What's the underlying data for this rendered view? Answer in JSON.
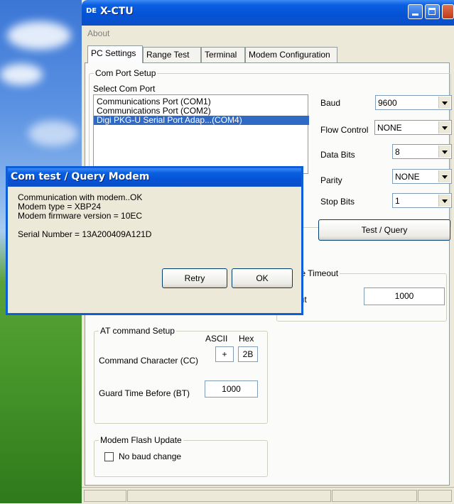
{
  "window": {
    "title": "X-CTU",
    "app_icon_text": "DE",
    "minimize_icon": "minimize-icon",
    "maximize_icon": "maximize-icon",
    "close_icon": "close-icon"
  },
  "menu": {
    "about": "About"
  },
  "tabs": [
    "PC Settings",
    "Range Test",
    "Terminal",
    "Modem Configuration"
  ],
  "com_port_setup": {
    "group_label": "Com Port Setup",
    "select_label": "Select Com Port",
    "ports": [
      "Communications Port (COM1)",
      "Communications Port (COM2)",
      "Digi PKG-U Serial Port Adap...(COM4)"
    ],
    "selected_index": 2,
    "baud_label": "Baud",
    "baud_value": "9600",
    "flow_label": "Flow Control",
    "flow_value": "NONE",
    "data_bits_label": "Data Bits",
    "data_bits_value": "8",
    "parity_label": "Parity",
    "parity_value": "NONE",
    "stop_bits_label": "Stop Bits",
    "stop_bits_value": "1",
    "test_button": "Test / Query"
  },
  "response_timeout": {
    "group_label_visible": "onse Timeout",
    "field_label_visible": "out",
    "value": "1000"
  },
  "at_command": {
    "group_label": "AT command Setup",
    "ascii_header": "ASCII",
    "hex_header": "Hex",
    "cc_label": "Command Character (CC)",
    "cc_ascii": "+",
    "cc_hex": "2B",
    "bt_label": "Guard Time Before (BT)",
    "bt_value": "1000"
  },
  "flash_update": {
    "group_label": "Modem Flash Update",
    "checkbox_label": "No baud change",
    "checked": false
  },
  "dialog": {
    "title": "Com test / Query Modem",
    "lines": [
      "Communication with modem..OK",
      "Modem type = XBP24",
      "Modem firmware version = 10EC"
    ],
    "serial": "Serial Number = 13A200409A121D",
    "retry_button": "Retry",
    "ok_button": "OK"
  },
  "colors": {
    "titlebar": "#0553d6",
    "selection": "#316ac5",
    "window_bg": "#ece9d8"
  }
}
